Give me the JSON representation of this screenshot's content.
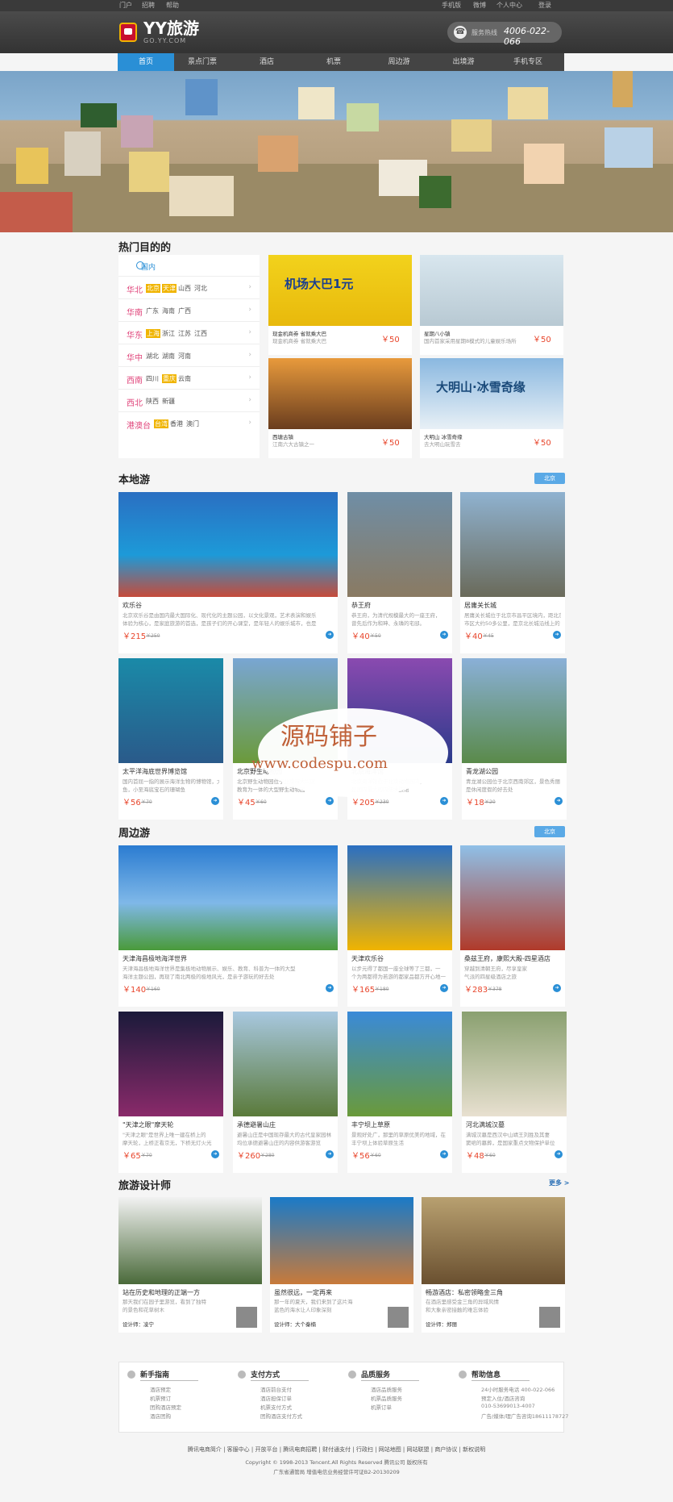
{
  "topbar": {
    "left": [
      "门户",
      "招聘",
      "帮助"
    ],
    "right": [
      "手机版",
      "微博",
      "个人中心",
      "登录"
    ]
  },
  "header": {
    "logo": "YY旅游",
    "logo_sub": "GO.YY.COM",
    "hotline_label": "服务热线",
    "hotline_number": "4006-022-066"
  },
  "nav": [
    "首页",
    "景点门票",
    "酒店",
    "机票",
    "周边游",
    "出境游",
    "手机专区"
  ],
  "hot": {
    "title": "热门目的的",
    "tab": "国内",
    "regions": [
      {
        "name": "华北",
        "cities": [
          {
            "n": "北京",
            "hl": true
          },
          {
            "n": "天津",
            "hl": true
          },
          {
            "n": "山西"
          },
          {
            "n": "河北"
          }
        ]
      },
      {
        "name": "华南",
        "cities": [
          {
            "n": "广东"
          },
          {
            "n": "海南"
          },
          {
            "n": "广西"
          }
        ]
      },
      {
        "name": "华东",
        "cities": [
          {
            "n": "上海",
            "hl": true
          },
          {
            "n": "浙江"
          },
          {
            "n": "江苏"
          },
          {
            "n": "江西"
          }
        ]
      },
      {
        "name": "华中",
        "cities": [
          {
            "n": "湖北"
          },
          {
            "n": "湖南"
          },
          {
            "n": "河南"
          }
        ]
      },
      {
        "name": "西南",
        "cities": [
          {
            "n": "四川"
          },
          {
            "n": "重庆",
            "hl": true
          },
          {
            "n": "云南"
          }
        ]
      },
      {
        "name": "西北",
        "cities": [
          {
            "n": "陕西"
          },
          {
            "n": "新疆"
          }
        ]
      },
      {
        "name": "港澳台",
        "cities": [
          {
            "n": "台湾",
            "hl": true
          },
          {
            "n": "香港"
          },
          {
            "n": "澳门"
          }
        ]
      }
    ],
    "promos": [
      {
        "title": "机场大巴1元",
        "line1": "现金机商券 省就乘大巴",
        "line2": "现金机商券 省就乘大巴",
        "price": "￥50"
      },
      {
        "title": "",
        "line1": "星期八小镇",
        "line2": "国内首家采用星期8模式的儿童娱乐场所",
        "price": "￥50"
      },
      {
        "title": "",
        "line1": "西塘古镇",
        "line2": "江南六大古镇之一",
        "price": "￥50"
      },
      {
        "title": "大明山·冰雪奇缘",
        "line1": "大明山 冰雪奇缘",
        "line2": "去大明山玩雪去",
        "price": "￥50"
      }
    ]
  },
  "local": {
    "title": "本地游",
    "tag": "北京",
    "items": [
      {
        "title": "欢乐谷",
        "desc1": "北京欢乐谷是由国内最大国际化、现代化的主题公园，以文化景观，艺术表演和娱乐",
        "desc2": "体验为核心，是家庭旅游的首选，是孩子们的开心课堂，是年轻人的娱乐城市，也是",
        "price": "￥215",
        "old": "￥250"
      },
      {
        "title": "恭王府",
        "desc1": "恭王府，为清代规模最大的一座王府，",
        "desc2": "曾先后作为和珅、永璘的宅邸。",
        "price": "￥40",
        "old": "￥50"
      },
      {
        "title": "居庸关长城",
        "desc1": "居庸关长城位于北京市昌平区境内，距北京",
        "desc2": "市区大约50多公里，是京北长城沿线上的",
        "price": "￥40",
        "old": "￥45"
      },
      {
        "title": "太平洋海底世界博览馆",
        "desc1": "国内首屈一指的展示海洋生物的博物馆，大到鲨",
        "desc2": "鱼，小至海底宝石的珊瑚鱼",
        "price": "￥56",
        "old": "￥70"
      },
      {
        "title": "北京野生动物园",
        "desc1": "北京野生动物园位于北京市大兴区",
        "desc2": "教育为一体的大型野生动物园",
        "price": "￥45",
        "old": "￥60"
      },
      {
        "title": "北京海洋馆",
        "desc1": "北京海洋馆位于北京动物园内，",
        "desc2": "是国内最大的内陆水族馆",
        "price": "￥205",
        "old": "￥230"
      },
      {
        "title": "青龙湖公园",
        "desc1": "青龙湖公园位于北京西南郊区，景色秀丽",
        "desc2": "是休闲度假的好去处",
        "price": "￥18",
        "old": "￥20"
      }
    ]
  },
  "nearby": {
    "title": "周边游",
    "tag": "北京",
    "items": [
      {
        "title": "天津海昌极地海洋世界",
        "desc1": "天津海昌极地海洋世界是集极地动物展示、娱乐、教育、科普为一体的大型",
        "desc2": "海洋主题公园，再现了南北两极的极地风光，是亲子游玩的好去处",
        "price": "￥140",
        "old": "￥160"
      },
      {
        "title": "天津欢乐谷",
        "desc1": "以步元得了都国一座全球等了三都，一",
        "desc2": "个为两都得为若游的都家品都方开心地一",
        "price": "￥165",
        "old": "￥180"
      },
      {
        "title": "桑兹王府，康熙大殿-四星酒店",
        "desc1": "穿越到清朝王府，尽享皇家",
        "desc2": "气派的四星级酒店之旅",
        "price": "￥283",
        "old": "￥378"
      },
      {
        "title": "\"天津之眼\"摩天轮",
        "desc1": "\"天津之眼\"是世界上唯一建在桥上的",
        "desc2": "摩天轮，上桥正看京无，下桥无灯火光",
        "price": "￥65",
        "old": "￥70"
      },
      {
        "title": "承德避暑山庄",
        "desc1": "避暑山庄是中国现存最大的古代皇家园林",
        "desc2": "均位承德避暑山庄的内容供游客游览",
        "price": "￥260",
        "old": "￥280"
      },
      {
        "title": "丰宁坝上草原",
        "desc1": "景观好处广，那里的草原优美的地域，在",
        "desc2": "丰宁坝上体验草原生活",
        "price": "￥56",
        "old": "￥60"
      },
      {
        "title": "河北满城汉墓",
        "desc1": "满城汉墓是西汉中山靖王刘胜及其妻",
        "desc2": "窦绾的墓葬，是国家重点文物保护单位",
        "price": "￥48",
        "old": "￥60"
      }
    ]
  },
  "designer": {
    "title": "旅游设计师",
    "more": "更多 >",
    "label": "设计师：",
    "items": [
      {
        "title": "站在历史和地理的正端一方",
        "desc1": "那天我们在园子里游览，看到了独特",
        "desc2": "的景色和花草树木",
        "name": "凌宁"
      },
      {
        "title": "虽然很远，一定再来",
        "desc1": "那一年的夏天，我们来到了这片海",
        "desc2": "蓝色的海水让人印象深刻",
        "name": "大个秦楠"
      },
      {
        "title": "畅游酒店：私密领略金三角",
        "desc1": "在酒店里感受金三角的异域风情",
        "desc2": "和大象亲密接触的难忘体验",
        "name": "郑丽"
      }
    ]
  },
  "footer": {
    "cols": [
      {
        "title": "新手指南",
        "items": [
          "酒店预定",
          "机票预订",
          "团购酒店预定",
          "酒店团购"
        ]
      },
      {
        "title": "支付方式",
        "items": [
          "酒店前台支付",
          "酒店担保订单",
          "机票支付方式",
          "团购酒店支付方式"
        ]
      },
      {
        "title": "品质服务",
        "items": [
          "酒店品质服务",
          "机票品质服务",
          "机票订单"
        ]
      },
      {
        "title": "帮助信息",
        "items": [
          "24小时服务电话 400-022-066",
          "预定入住/酒店咨询",
          "010-53699013-4007",
          "广告/媒体/理广告咨询18611178727"
        ]
      }
    ],
    "links": "腾讯电商简介 | 客服中心 | 开放平台 | 腾讯电商招聘 | 财付通支付 | 行政扫 | 网站地图 | 网站联盟 | 商户协议 | 新权说明",
    "copy": "Copyright © 1998-2013 Tencent.All Rights Reserved 腾讯公司 版权所有",
    "icp": "广东省通管局 增值电信业务经营许可证B2-20130209"
  },
  "watermark": {
    "cn": "源码铺子",
    "url": "www.codespu.com"
  }
}
